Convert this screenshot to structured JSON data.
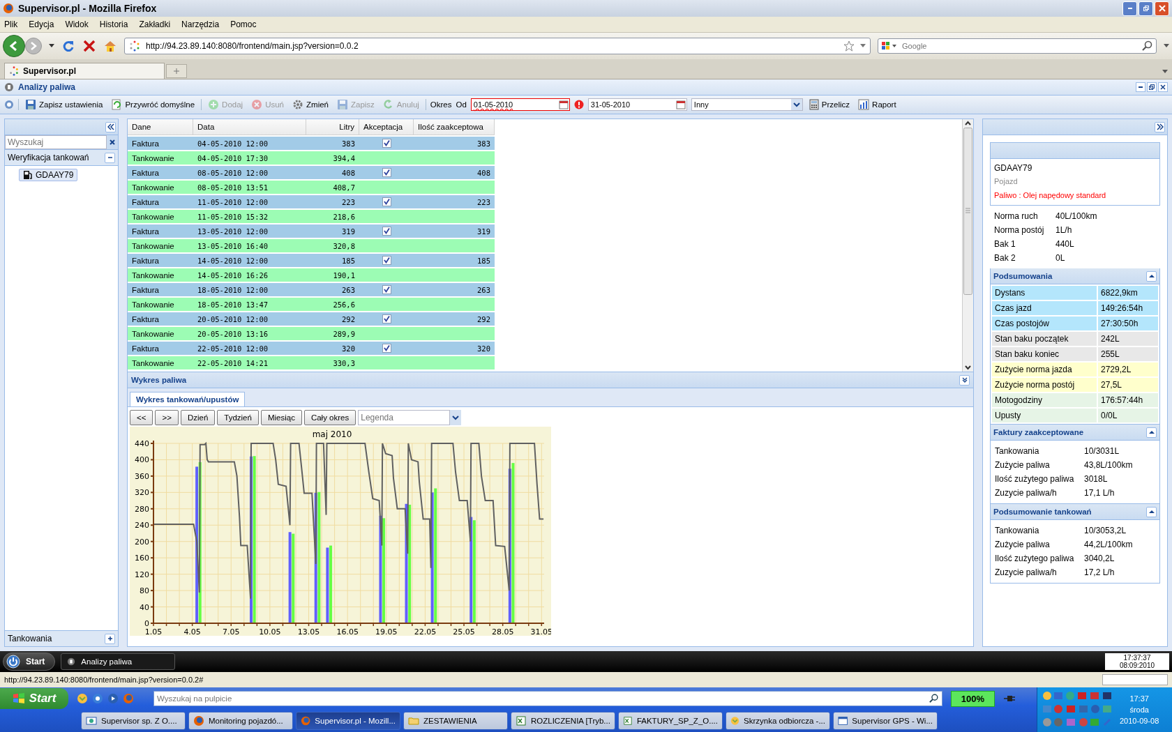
{
  "browser": {
    "title": "Supervisor.pl - Mozilla Firefox",
    "menu": [
      "Plik",
      "Edycja",
      "Widok",
      "Historia",
      "Zakładki",
      "Narzędzia",
      "Pomoc"
    ],
    "url": "http://94.23.89.140:8080/frontend/main.jsp?version=0.0.2",
    "search_placeholder": "Google",
    "tabs": [
      {
        "label": "Supervisor.pl",
        "selected": true
      }
    ],
    "status": "http://94.23.89.140:8080/frontend/main.jsp?version=0.0.2#"
  },
  "app": {
    "title": "Analizy paliwa",
    "toolbar": [
      {
        "label": "Zapisz ustawienia",
        "disabled": false
      },
      {
        "label": "Przywróć domyślne",
        "disabled": false
      },
      {
        "label": "Dodaj",
        "disabled": true
      },
      {
        "label": "Usuń",
        "disabled": true
      },
      {
        "label": "Zmień",
        "disabled": false
      },
      {
        "label": "Zapisz",
        "disabled": true
      },
      {
        "label": "Anuluj",
        "disabled": true
      }
    ],
    "period_label": "Okres",
    "from_label": "Od",
    "date_from": {
      "value": "01-05-2010",
      "invalid": true
    },
    "date_to": {
      "value": "31-05-2010"
    },
    "range": {
      "value": "Inny"
    },
    "actions": [
      {
        "label": "Przelicz"
      },
      {
        "label": "Raport"
      }
    ]
  },
  "left": {
    "search_placeholder": "Wyszukaj",
    "group": {
      "label": "Weryfikacja tankowań",
      "expanded": true,
      "children": [
        {
          "label": "GDAAY79",
          "selected": true
        }
      ]
    },
    "footer": {
      "label": "Tankowania",
      "expanded": false
    }
  },
  "table": {
    "columns": [
      "Dane",
      "Data",
      "Litry",
      "Akceptacja",
      "Ilość zaakceptowa"
    ],
    "rows": [
      {
        "kind": "faktura",
        "dane": "Faktura",
        "data": "04-05-2010 12:00",
        "litry": "383",
        "checked": true,
        "accepted": "383"
      },
      {
        "kind": "tankowanie",
        "dane": "Tankowanie",
        "data": "04-05-2010 17:30",
        "litry": "394,4"
      },
      {
        "kind": "faktura",
        "dane": "Faktura",
        "data": "08-05-2010 12:00",
        "litry": "408",
        "checked": true,
        "accepted": "408"
      },
      {
        "kind": "tankowanie",
        "dane": "Tankowanie",
        "data": "08-05-2010 13:51",
        "litry": "408,7"
      },
      {
        "kind": "faktura",
        "dane": "Faktura",
        "data": "11-05-2010 12:00",
        "litry": "223",
        "checked": true,
        "accepted": "223"
      },
      {
        "kind": "tankowanie",
        "dane": "Tankowanie",
        "data": "11-05-2010 15:32",
        "litry": "218,6"
      },
      {
        "kind": "faktura",
        "dane": "Faktura",
        "data": "13-05-2010 12:00",
        "litry": "319",
        "checked": true,
        "accepted": "319"
      },
      {
        "kind": "tankowanie",
        "dane": "Tankowanie",
        "data": "13-05-2010 16:40",
        "litry": "320,8"
      },
      {
        "kind": "faktura",
        "dane": "Faktura",
        "data": "14-05-2010 12:00",
        "litry": "185",
        "checked": true,
        "accepted": "185"
      },
      {
        "kind": "tankowanie",
        "dane": "Tankowanie",
        "data": "14-05-2010 16:26",
        "litry": "190,1"
      },
      {
        "kind": "faktura",
        "dane": "Faktura",
        "data": "18-05-2010 12:00",
        "litry": "263",
        "checked": true,
        "accepted": "263"
      },
      {
        "kind": "tankowanie",
        "dane": "Tankowanie",
        "data": "18-05-2010 13:47",
        "litry": "256,6"
      },
      {
        "kind": "faktura",
        "dane": "Faktura",
        "data": "20-05-2010 12:00",
        "litry": "292",
        "checked": true,
        "accepted": "292"
      },
      {
        "kind": "tankowanie",
        "dane": "Tankowanie",
        "data": "20-05-2010 13:16",
        "litry": "289,9"
      },
      {
        "kind": "faktura",
        "dane": "Faktura",
        "data": "22-05-2010 12:00",
        "litry": "320",
        "checked": true,
        "accepted": "320"
      },
      {
        "kind": "tankowanie",
        "dane": "Tankowanie",
        "data": "22-05-2010 14:21",
        "litry": "330,3"
      }
    ]
  },
  "chart_section": {
    "title": "Wykres paliwa",
    "expanded": true,
    "tabs": [
      {
        "label": "Wykres tankowań/upustów",
        "selected": true
      }
    ],
    "buttons": [
      "<<",
      ">>",
      "Dzień",
      "Tydzień",
      "Miesiąc",
      "Cały okres"
    ],
    "legend_placeholder": "Legenda",
    "chart_data": {
      "type": "bar",
      "title": "maj 2010",
      "grid": true,
      "xlim": [
        1.05,
        31.25
      ],
      "ylim": [
        0,
        440
      ],
      "xticks": [
        1.05,
        4.05,
        7.05,
        10.05,
        13.05,
        16.05,
        19.05,
        22.05,
        25.05,
        28.05,
        31.05
      ],
      "yticks": [
        0,
        40,
        80,
        120,
        160,
        200,
        240,
        280,
        320,
        360,
        400,
        440
      ],
      "series": [
        {
          "type": "bar",
          "color": "#6060ff",
          "x": [
            4.4,
            8.6,
            11.6,
            13.6,
            14.5,
            18.6,
            20.6,
            22.6,
            25.6,
            28.6
          ],
          "values": [
            383,
            408,
            223,
            319,
            185,
            263,
            292,
            320,
            260,
            378
          ]
        },
        {
          "type": "bar",
          "color": "#66ff44",
          "x": [
            4.65,
            8.85,
            11.85,
            13.85,
            14.75,
            18.85,
            20.85,
            22.85,
            25.85,
            28.85
          ],
          "values": [
            394,
            409,
            219,
            321,
            190,
            257,
            290,
            330,
            252,
            392
          ]
        },
        {
          "type": "line",
          "color": "#606060",
          "x": [
            1.05,
            4.15,
            4.4,
            4.6,
            4.65,
            5,
            5.1,
            5.2,
            5.3,
            7.3,
            7.5,
            7.7,
            7.8,
            8.3,
            8.55,
            8.6,
            10.3,
            10.5,
            10.7,
            11.3,
            11.6,
            11.65,
            12.3,
            12.5,
            12.7,
            13.3,
            13.6,
            13.65,
            14.2,
            14.4,
            14.45,
            17.4,
            17.7,
            18,
            18.5,
            18.7,
            18.75,
            19,
            19.5,
            19.6,
            19.9,
            20.5,
            20.7,
            20.75,
            21,
            21.5,
            21.6,
            21.9,
            22.4,
            22.5,
            22.55,
            24.2,
            24.4,
            24.7,
            25.3,
            25.55,
            25.6,
            26.2,
            26.4,
            26.7,
            27.3,
            27.5,
            28.2,
            28.55,
            28.6,
            30.5,
            30.7,
            30.9,
            31.2
          ],
          "values": [
            242,
            242,
            200,
            75,
            437,
            437,
            440,
            400,
            395,
            395,
            360,
            260,
            190,
            190,
            60,
            440,
            440,
            400,
            340,
            335,
            240,
            440,
            440,
            380,
            318,
            318,
            145,
            440,
            440,
            265,
            440,
            440,
            370,
            305,
            300,
            190,
            440,
            415,
            410,
            355,
            280,
            280,
            170,
            440,
            400,
            395,
            345,
            255,
            255,
            135,
            440,
            440,
            370,
            300,
            300,
            200,
            440,
            440,
            360,
            300,
            300,
            190,
            188,
            80,
            440,
            440,
            340,
            255,
            255
          ]
        }
      ]
    }
  },
  "right": {
    "vehicle": {
      "plate": "GDAAY79",
      "type": "Pojazd",
      "fuel": "Paliwo : Olej napędowy standard"
    },
    "norms": [
      {
        "label": "Norma ruch",
        "value": "40L/100km"
      },
      {
        "label": "Norma postój",
        "value": "1L/h"
      },
      {
        "label": "Bak 1",
        "value": "440L"
      },
      {
        "label": "Bak 2",
        "value": "0L"
      }
    ],
    "sections": [
      {
        "title": "Podsumowania",
        "expanded": true,
        "rows": [
          {
            "label": "Dystans",
            "value": "6822,9km",
            "color": "#b4e6fc"
          },
          {
            "label": "Czas jazd",
            "value": "149:26:54h",
            "color": "#b4e6fc"
          },
          {
            "label": "Czas postojów",
            "value": "27:30:50h",
            "color": "#b4e6fc"
          },
          {
            "label": "Stan baku początek",
            "value": "242L",
            "color": "#e8e8e8"
          },
          {
            "label": "Stan baku koniec",
            "value": "255L",
            "color": "#e8e8e8"
          },
          {
            "label": "Zużycie norma jazda",
            "value": "2729,2L",
            "color": "#ffffcc"
          },
          {
            "label": "Zużycie norma postój",
            "value": "27,5L",
            "color": "#ffffcc"
          },
          {
            "label": "Motogodziny",
            "value": "176:57:44h",
            "color": "#e6f4e6"
          },
          {
            "label": "Upusty",
            "value": "0/0L",
            "color": "#e6f4e6"
          }
        ]
      },
      {
        "title": "Faktury zaakceptowane",
        "expanded": true,
        "rows": [
          {
            "label": "Tankowania",
            "value": "10/3031L"
          },
          {
            "label": "Zużycie paliwa",
            "value": "43,8L/100km"
          },
          {
            "label": "Ilość zużytego paliwa",
            "value": "3018L"
          },
          {
            "label": "Zuzycie paliwa/h",
            "value": "17,1 L/h"
          }
        ]
      },
      {
        "title": "Podsumowanie tankowań",
        "expanded": true,
        "rows": [
          {
            "label": "Tankowania",
            "value": "10/3053,2L"
          },
          {
            "label": "Zużycie paliwa",
            "value": "44,2L/100km"
          },
          {
            "label": "Ilość zużytego paliwa",
            "value": "3040,2L"
          },
          {
            "label": "Zuzycie paliwa/h",
            "value": "17,2 L/h"
          }
        ]
      }
    ]
  },
  "app_taskbar": {
    "start": "Start",
    "tasks": [
      {
        "label": "Analizy paliwa"
      }
    ],
    "time": "17:37:37",
    "date": "08:09:2010"
  },
  "taskbar": {
    "start": "Start",
    "search_placeholder": "Wyszukaj na pulpicie",
    "battery": "100%",
    "tasks": [
      {
        "label": "Supervisor sp. Z O....",
        "selected": false
      },
      {
        "label": "Monitoring pojazdó...",
        "selected": false
      },
      {
        "label": "Supervisor.pl - Mozill...",
        "selected": true
      },
      {
        "label": "ZESTAWIENIA",
        "selected": false
      },
      {
        "label": "ROZLICZENIA  [Tryb...",
        "selected": false
      },
      {
        "label": "FAKTURY_SP_Z_O....",
        "selected": false
      },
      {
        "label": "Skrzynka odbiorcza -...",
        "selected": false
      },
      {
        "label": "Supervisor GPS - Wi...",
        "selected": false
      }
    ],
    "time": "17:37",
    "day": "środa",
    "date": "2010-09-08"
  }
}
